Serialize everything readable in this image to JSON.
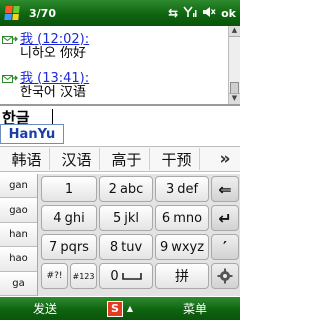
{
  "statusbar": {
    "title": "3/70",
    "icons": {
      "connectivity": "⇆",
      "signal": "Y",
      "volume": "◀×"
    },
    "ok_label": "ok"
  },
  "chat": {
    "messages": [
      {
        "sender": "我 (12:02):",
        "text": "니하오 你好"
      },
      {
        "sender": "我 (13:41):",
        "text": "한국어 汉语"
      }
    ]
  },
  "input": {
    "value": "한글"
  },
  "composition": {
    "text": "HanYu"
  },
  "candidates": {
    "items": [
      "韩语",
      "汉语",
      "高于",
      "干预"
    ],
    "more_label": "»"
  },
  "keyboard": {
    "pinyin_options": [
      "gan",
      "gao",
      "han",
      "hao",
      "ga"
    ],
    "keys": {
      "k1": {
        "digit": "1",
        "letters": ""
      },
      "k2": {
        "digit": "2",
        "letters": "abc"
      },
      "k3": {
        "digit": "3",
        "letters": "def"
      },
      "k4": {
        "digit": "4",
        "letters": "ghi"
      },
      "k5": {
        "digit": "5",
        "letters": "jkl"
      },
      "k6": {
        "digit": "6",
        "letters": "mno"
      },
      "k7": {
        "digit": "7",
        "letters": "pqrs"
      },
      "k8": {
        "digit": "8",
        "letters": "tuv"
      },
      "k9": {
        "digit": "9",
        "letters": "wxyz"
      },
      "symbols": "#?!",
      "numeric": "#123",
      "space": "0",
      "pinyin_mode": "拼",
      "backspace": "⇐",
      "enter": "↵",
      "apostrophe": "′"
    }
  },
  "menubar": {
    "left_softkey": "发送",
    "right_softkey": "菜单",
    "ime_logo": "S"
  },
  "colors": {
    "accent_green": "#0f6410",
    "link_blue": "#1b2ad8"
  }
}
